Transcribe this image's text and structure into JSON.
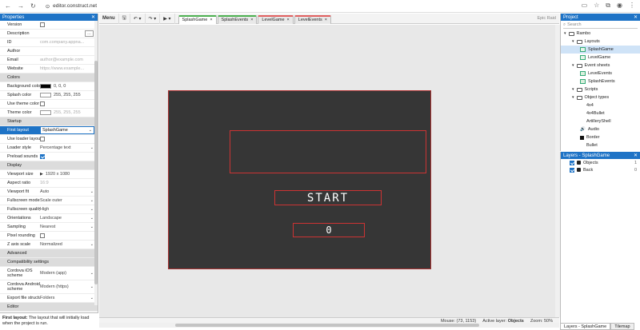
{
  "browser": {
    "url": "editor.construct.net"
  },
  "properties": {
    "title": "Properties",
    "rows": [
      {
        "type": "row",
        "key": "Version",
        "value": "",
        "control": "checkbox",
        "checked": false
      },
      {
        "type": "row",
        "key": "Description",
        "value": "",
        "control": "ellipsis"
      },
      {
        "type": "row",
        "key": "ID",
        "value": "com.company.appna...",
        "muted": true
      },
      {
        "type": "row",
        "key": "Author",
        "value": ""
      },
      {
        "type": "row",
        "key": "Email",
        "value": "author@example.com",
        "muted": true
      },
      {
        "type": "row",
        "key": "Website",
        "value": "https://www.example...",
        "muted": true
      },
      {
        "type": "section",
        "key": "Colors"
      },
      {
        "type": "row",
        "key": "Background color",
        "value": "0, 0, 0",
        "control": "swatch",
        "swatch": "#000000"
      },
      {
        "type": "row",
        "key": "Splash color",
        "value": "255, 255, 255",
        "control": "swatch",
        "swatch": "#ffffff"
      },
      {
        "type": "row",
        "key": "Use theme color",
        "value": "",
        "control": "checkbox",
        "checked": false
      },
      {
        "type": "row",
        "key": "Theme color",
        "value": "255, 255, 255",
        "control": "swatch",
        "swatch": "#ffffff",
        "muted": true
      },
      {
        "type": "section",
        "key": "Startup"
      },
      {
        "type": "row",
        "key": "First layout",
        "value": "SplashGame",
        "control": "select",
        "selected": true
      },
      {
        "type": "row",
        "key": "Use loader layout",
        "value": "",
        "control": "checkbox",
        "checked": false
      },
      {
        "type": "row",
        "key": "Loader style",
        "value": "Percentage text",
        "control": "select"
      },
      {
        "type": "row",
        "key": "Preload sounds",
        "value": "",
        "control": "checkbox",
        "checked": true
      },
      {
        "type": "section",
        "key": "Display"
      },
      {
        "type": "row",
        "key": "Viewport size",
        "value": "1920 x 1080",
        "control": "expand"
      },
      {
        "type": "row",
        "key": "Aspect ratio",
        "value": "16:9",
        "muted": true
      },
      {
        "type": "row",
        "key": "Viewport fit",
        "value": "Auto",
        "control": "select"
      },
      {
        "type": "row",
        "key": "Fullscreen mode",
        "value": "Scale outer",
        "control": "select"
      },
      {
        "type": "row",
        "key": "Fullscreen quality",
        "value": "High",
        "control": "select"
      },
      {
        "type": "row",
        "key": "Orientations",
        "value": "Landscape",
        "control": "select"
      },
      {
        "type": "row",
        "key": "Sampling",
        "value": "Nearest",
        "control": "select"
      },
      {
        "type": "row",
        "key": "Pixel rounding",
        "value": "",
        "control": "checkbox",
        "checked": false
      },
      {
        "type": "row",
        "key": "Z axis scale",
        "value": "Normalized",
        "control": "select"
      },
      {
        "type": "section",
        "key": "Advanced"
      },
      {
        "type": "section",
        "key": "Compatibility settings"
      },
      {
        "type": "row",
        "key": "Cordova iOS scheme",
        "value": "Modern (app)",
        "control": "select",
        "tall": true
      },
      {
        "type": "row",
        "key": "Cordova Android scheme",
        "value": "Modern (https)",
        "control": "select",
        "tall": true
      },
      {
        "type": "row",
        "key": "Export file structure",
        "value": "Folders",
        "control": "select"
      },
      {
        "type": "section",
        "key": "Editor"
      }
    ],
    "help_title": "First layout:",
    "help_text": " The layout that will initially load when the project is run."
  },
  "toolbar": {
    "menu": "Menu",
    "tabs": [
      {
        "label": "SplashGame",
        "color": "#4caf50",
        "active": true
      },
      {
        "label": "SplashEvents",
        "color": "#4caf50"
      },
      {
        "label": "LevelGame",
        "color": "#e06060"
      },
      {
        "label": "LevelEvents",
        "color": "#e06060"
      }
    ],
    "brand": "Epic Raid"
  },
  "canvas": {
    "start_label": "START",
    "score_value": "0"
  },
  "status": {
    "mouse": "Mouse: (73, 1153)",
    "active_layer_label": "Active layer:",
    "active_layer": "Objects",
    "zoom": "Zoom: 50%"
  },
  "project": {
    "title": "Project",
    "search_placeholder": "Search",
    "tree": [
      {
        "label": "Rambo",
        "depth": 0,
        "icon": "folder"
      },
      {
        "label": "Layouts",
        "depth": 1,
        "icon": "folder"
      },
      {
        "label": "SplashGame",
        "depth": 2,
        "icon": "layout",
        "selected": true
      },
      {
        "label": "LevelGame",
        "depth": 2,
        "icon": "layout"
      },
      {
        "label": "Event sheets",
        "depth": 1,
        "icon": "folder"
      },
      {
        "label": "LevelEvents",
        "depth": 2,
        "icon": "events"
      },
      {
        "label": "SplashEvents",
        "depth": 2,
        "icon": "events"
      },
      {
        "label": "Scripts",
        "depth": 1,
        "icon": "folder"
      },
      {
        "label": "Object types",
        "depth": 1,
        "icon": "folder"
      },
      {
        "label": "4x4",
        "depth": 2,
        "icon": "none"
      },
      {
        "label": "4x4Bullet",
        "depth": 2,
        "icon": "none"
      },
      {
        "label": "ArtilleryShell",
        "depth": 2,
        "icon": "none"
      },
      {
        "label": "Audio",
        "depth": 2,
        "icon": "audio"
      },
      {
        "label": "Border",
        "depth": 2,
        "icon": "square"
      },
      {
        "label": "Bullet",
        "depth": 2,
        "icon": "none"
      }
    ]
  },
  "layers": {
    "title": "Layers - SplashGame",
    "rows": [
      {
        "label": "Objects",
        "num": "1"
      },
      {
        "label": "Back",
        "num": "0"
      }
    ],
    "bottom_tabs": [
      "Layers - SplashGame",
      "Tilemap"
    ]
  }
}
